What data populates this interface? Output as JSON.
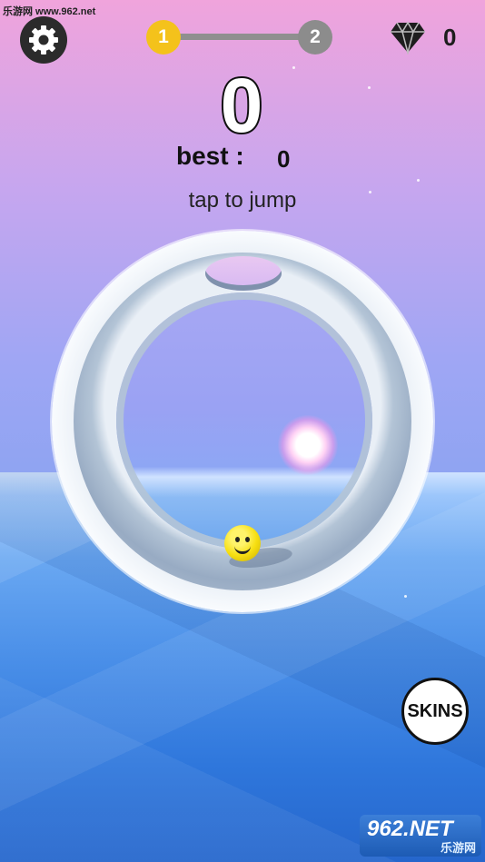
{
  "watermark": "乐游网 www.962.net",
  "level": {
    "current": "1",
    "next": "2"
  },
  "gems": {
    "count": "0"
  },
  "score": "0",
  "best": {
    "label": "best :",
    "value": "0"
  },
  "hint": "tap to jump",
  "skins_label": "SKINS",
  "brand": {
    "logo": "962.NET",
    "sub": "乐游网"
  },
  "icons": {
    "settings": "gear-icon",
    "gems": "diamond-icon",
    "player": "smiley-ball"
  },
  "colors": {
    "level_current": "#f4c21b",
    "level_next": "#8c8c8c",
    "ball": "#f7df12",
    "settings_bg": "#2b2b2b"
  }
}
